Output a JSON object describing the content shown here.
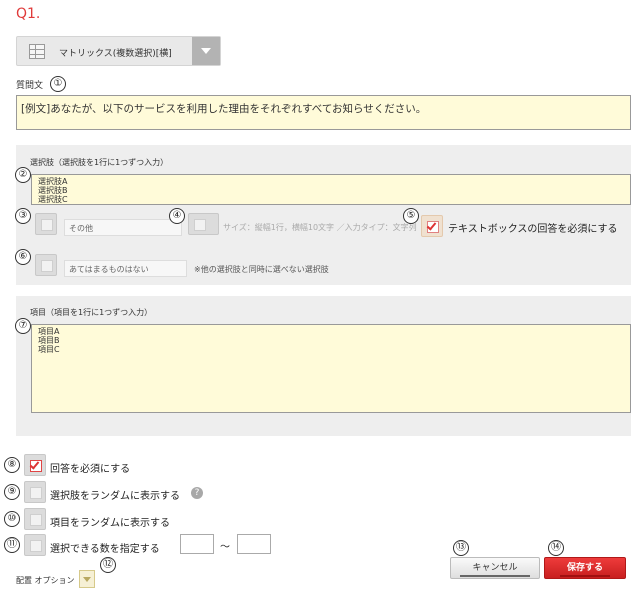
{
  "question_number": "Q1.",
  "question_type": {
    "label": "マトリックス(複数選択)[横]",
    "icon": "matrix-grid-icon"
  },
  "question_text": {
    "label": "質問文",
    "value": "[例文]あなたが、以下のサービスを利用した理由をそれぞれすべてお知らせください。"
  },
  "choices": {
    "label": "選択肢（選択肢を1行に1つずつ入力）",
    "items": [
      "選択肢A",
      "選択肢B",
      "選択肢C"
    ]
  },
  "other_option": {
    "placeholder": "その他",
    "size_info": "サイズ：縦幅1行，横幅10文字 ／入力タイプ：文字列",
    "textbox_required_label": "テキストボックスの回答を必須にする"
  },
  "none_option": {
    "placeholder": "あてはまるものはない",
    "note": "※他の選択肢と同時に選べない選択肢"
  },
  "items": {
    "label": "項目（項目を1行に1つずつ入力）",
    "values": [
      "項目A",
      "項目B",
      "項目C"
    ]
  },
  "options": {
    "required": "回答を必須にする",
    "random_choices": "選択肢をランダムに表示する",
    "random_items": "項目をランダムに表示する",
    "limit_selection": "選択できる数を指定する",
    "range_separator": "～",
    "help": "?"
  },
  "layout_option_label": "配置 オプション",
  "buttons": {
    "cancel": "キャンセル",
    "save": "保存する"
  },
  "markers": [
    "①",
    "②",
    "③",
    "④",
    "⑤",
    "⑥",
    "⑦",
    "⑧",
    "⑨",
    "⑩",
    "⑪",
    "⑫",
    "⑬",
    "⑭"
  ],
  "colors": {
    "accent": "#e03a3a",
    "input_bg": "#fffbd9",
    "panel_bg": "#eeeeee"
  }
}
